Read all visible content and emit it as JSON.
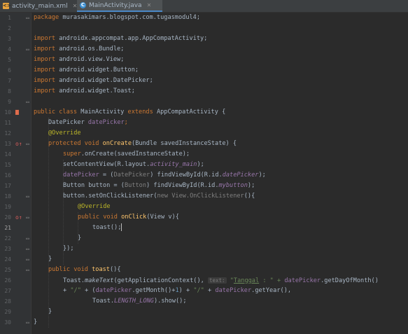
{
  "tabs": [
    {
      "label": "activity_main.xml",
      "icon": "xml-file-icon",
      "active": false
    },
    {
      "label": "MainActivity.java",
      "icon": "java-class-icon",
      "active": true
    }
  ],
  "line_numbers": [
    "1",
    "2",
    "3",
    "4",
    "5",
    "6",
    "7",
    "8",
    "9",
    "10",
    "11",
    "12",
    "13",
    "14",
    "15",
    "16",
    "17",
    "18",
    "19",
    "20",
    "21",
    "22",
    "23",
    "24",
    "25",
    "26",
    "27",
    "28",
    "29",
    "30"
  ],
  "current_line": 21,
  "code": {
    "l1": [
      "package ",
      "murasakimars.blogspot.com.tugasmodul4;"
    ],
    "l3": [
      "import ",
      "androidx.appcompat.app.AppCompatActivity;"
    ],
    "l4": [
      "import ",
      "android.os.Bundle;"
    ],
    "l5": [
      "import ",
      "android.view.View;"
    ],
    "l6": [
      "import ",
      "android.widget.Button;"
    ],
    "l7": [
      "import ",
      "android.widget.DatePicker;"
    ],
    "l8": [
      "import ",
      "android.widget.Toast;"
    ],
    "l10": [
      "public class ",
      "MainActivity ",
      "extends ",
      "AppCompatActivity {"
    ],
    "l11": [
      "DatePicker ",
      "datePicker",
      ";"
    ],
    "l12": [
      "@Override"
    ],
    "l13": [
      "protected void ",
      "onCreate",
      "(Bundle savedInstanceState) {"
    ],
    "l14": [
      "super",
      ".onCreate(savedInstanceState);"
    ],
    "l15": [
      "setContentView(R.layout.",
      "activity_main",
      ");"
    ],
    "l16": [
      "datePicker",
      " = (",
      "DatePicker",
      ") findViewById(R.id.",
      "datePicker",
      ");"
    ],
    "l17": [
      "Button button = (",
      "Button",
      ") findViewById(R.id.",
      "mybutton",
      ");"
    ],
    "l18": [
      "button.setOnClickListener(",
      "new ",
      "View.OnClickListener",
      "(){"
    ],
    "l19": [
      "@Override"
    ],
    "l20": [
      "public void ",
      "onClick",
      "(View v){"
    ],
    "l21": [
      "toast();"
    ],
    "l22": [
      "}"
    ],
    "l23": [
      "});"
    ],
    "l24": [
      "}"
    ],
    "l25": [
      "public void ",
      "toast",
      "(){"
    ],
    "l26": [
      "Toast.",
      "makeText",
      "(getApplicationContext(), ",
      "text:",
      " \"",
      "Tanggal",
      " : \" + ",
      "datePicker",
      ".getDayOfMonth()"
    ],
    "l27": [
      "+ ",
      "\"/\"",
      " + (",
      "datePicker",
      ".getMonth()+",
      "1",
      ") + ",
      "\"/\"",
      " + ",
      "datePicker",
      ".getYear(),"
    ],
    "l28": [
      "Toast.",
      "LENGTH_LONG",
      ").show();"
    ],
    "l29": [
      "}"
    ],
    "l30": [
      "}"
    ]
  },
  "colors": {
    "keyword": "#cc7832",
    "string": "#6a8759",
    "field": "#9876aa",
    "method_decl": "#ffc66d",
    "annotation": "#bbb529",
    "number": "#6897bb",
    "text": "#a9b7c6"
  }
}
